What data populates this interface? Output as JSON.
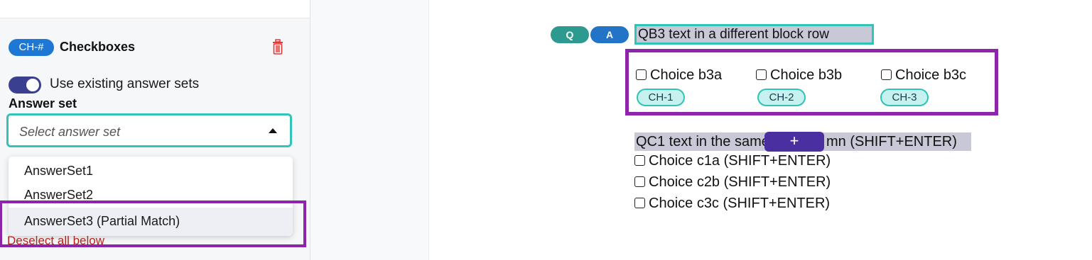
{
  "editor_panel": {
    "type_badge": "CH-#",
    "type_title": "Checkboxes",
    "toggle_label": "Use existing answer sets",
    "toggle_on": true,
    "answer_set_label": "Answer set",
    "select_placeholder": "Select answer set",
    "dropdown_options": [
      "AnswerSet1",
      "AnswerSet2",
      "AnswerSet3 (Partial Match)"
    ],
    "highlighted_option_index": 2,
    "deselect_label": "Deselect all below"
  },
  "canvas": {
    "q_badge": "Q",
    "a_badge": "A",
    "qb3_text": "QB3 text in a different block row",
    "choices": [
      {
        "label": "Choice b3a",
        "tag": "CH-1"
      },
      {
        "label": "Choice b3b",
        "tag": "CH-2"
      },
      {
        "label": "Choice b3c",
        "tag": "CH-3"
      }
    ],
    "qc1_text": "QC1 text in the same column (SHIFT+ENTER)",
    "qc1_before": "QC1 text in the same",
    "qc1_after": "mn (SHIFT+ENTER)",
    "plus_label": "+",
    "qc1_choices": [
      "Choice c1a (SHIFT+ENTER)",
      "Choice c2b (SHIFT+ENTER)",
      "Choice c3c (SHIFT+ENTER)"
    ]
  },
  "colors": {
    "accent_purple": "#8e24aa",
    "accent_teal": "#2ec4b6",
    "badge_blue": "#1e78d3",
    "toggle_navy": "#3b3f8f",
    "danger_red": "#b3261e"
  }
}
